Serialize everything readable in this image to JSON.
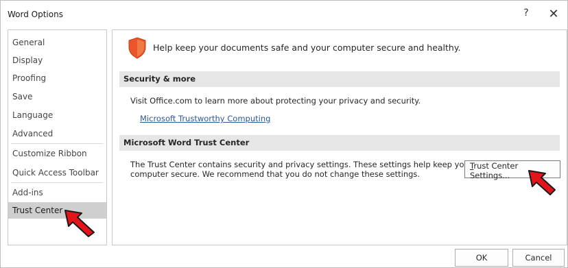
{
  "window": {
    "title": "Word Options",
    "help_label": "?",
    "close_label": "✕"
  },
  "nav": {
    "items": [
      {
        "label": "General"
      },
      {
        "label": "Display"
      },
      {
        "label": "Proofing"
      },
      {
        "label": "Save"
      },
      {
        "label": "Language"
      },
      {
        "label": "Advanced"
      },
      {
        "label": "Customize Ribbon"
      },
      {
        "label": "Quick Access Toolbar"
      },
      {
        "label": "Add-ins"
      },
      {
        "label": "Trust Center"
      }
    ],
    "selected": "Trust Center"
  },
  "content": {
    "intro": "Help keep your documents safe and your computer secure and healthy.",
    "security_header": "Security & more",
    "security_text": "Visit Office.com to learn more about protecting your privacy and security.",
    "security_link": "Microsoft Trustworthy Computing",
    "trust_header": "Microsoft Word Trust Center",
    "trust_text_line1": "The Trust Center contains security and privacy settings. These settings help keep your",
    "trust_text_line2": "computer secure. We recommend that you do not change these settings.",
    "trust_button_first": "T",
    "trust_button_rest": "rust Center Settings..."
  },
  "footer": {
    "ok_label": "OK",
    "cancel_label": "Cancel"
  },
  "colors": {
    "shield_orange": "#e8562a",
    "selected_bg": "#cfcfcf",
    "section_bg": "#e6e6e6",
    "link": "#2b579a",
    "annotation_arrow": "#e3151a"
  },
  "icons": {
    "shield": "shield-icon",
    "arrow": "red-arrow-annotation"
  }
}
